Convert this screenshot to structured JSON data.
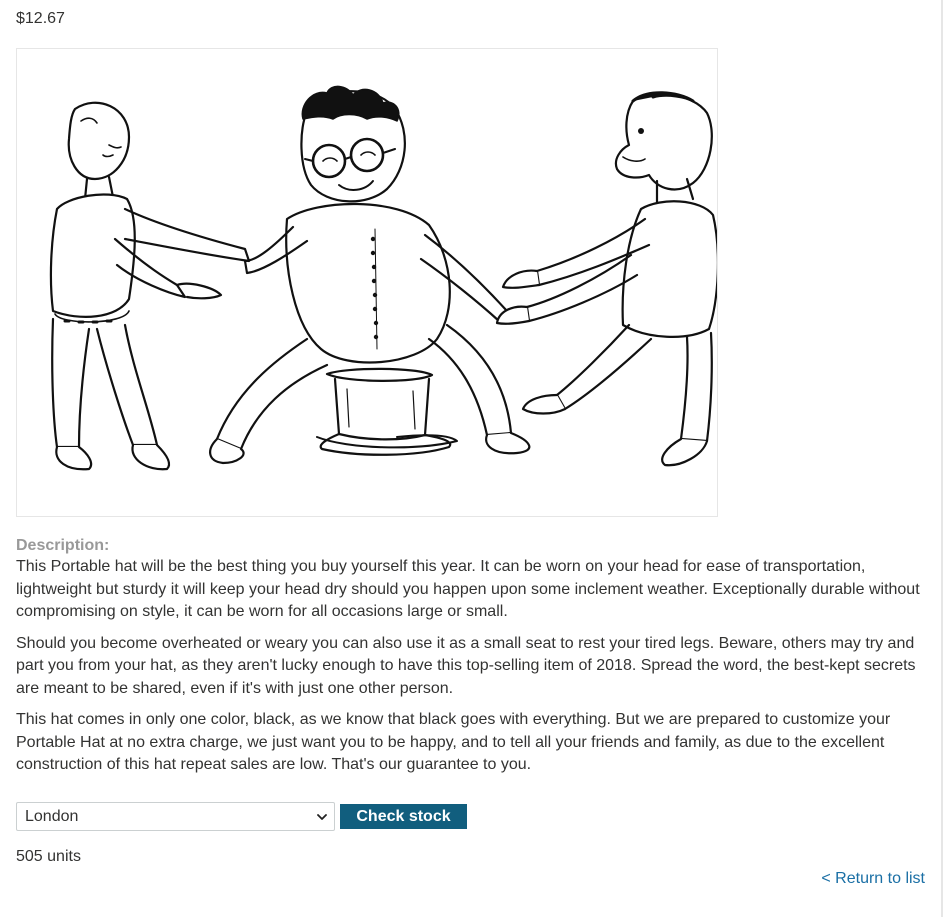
{
  "product": {
    "price": "$12.67",
    "image_alt": "Three people tugging at a man sitting on a portable hat"
  },
  "description": {
    "heading": "Description:",
    "paragraphs": [
      "This Portable hat will be the best thing you buy yourself this year. It can be worn on your head for ease of transportation, lightweight but sturdy it will keep your head dry should you happen upon some inclement weather. Exceptionally durable without compromising on style, it can be worn for all occasions large or small.",
      "Should you become overheated or weary you can also use it as a small seat to rest your tired legs. Beware, others may try and part you from your hat, as they aren't lucky enough to have this top-selling item of 2018. Spread the word, the best-kept secrets are meant to be shared, even if it's with just one other person.",
      "This hat comes in only one color, black, as we know that black goes with everything. But we are prepared to customize your Portable Hat at no extra charge, we just want you to be happy, and to tell all your friends and family, as due to the excellent construction of this hat repeat sales are low. That's our guarantee to you."
    ]
  },
  "stock_check": {
    "selected_store": "London",
    "button_label": "Check stock",
    "result": "505 units"
  },
  "navigation": {
    "return_link": "< Return to list"
  },
  "colors": {
    "button_bg": "#115e7e",
    "link": "#1a6fa5",
    "heading_muted": "#999999",
    "text": "#333332"
  },
  "icons": {
    "select_arrow": "chevron-down-icon"
  }
}
